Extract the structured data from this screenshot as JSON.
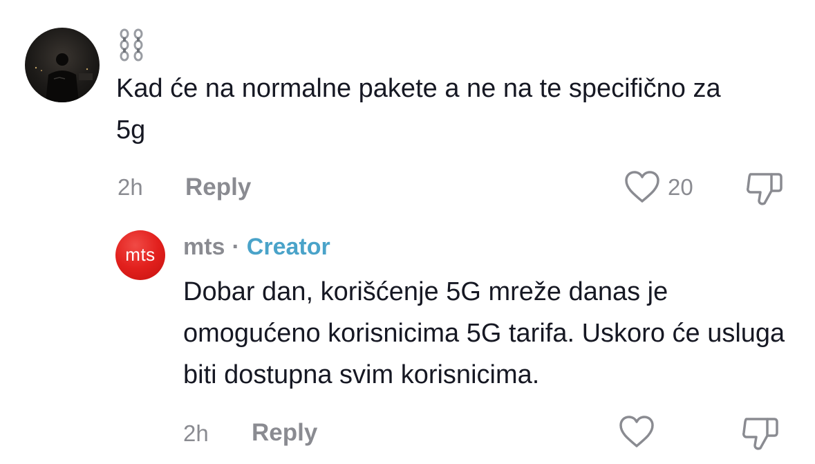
{
  "comments": [
    {
      "username": "⛓️",
      "text": "Kad će na normalne pakete a ne na te specifično za 5g",
      "time": "2h",
      "reply_label": "Reply",
      "like_count": "20",
      "avatar_icon": "person-silhouette-avatar"
    },
    {
      "username": "mts",
      "separator": "·",
      "badge": "Creator",
      "avatar_text": "mts",
      "text": "Dobar dan, korišćenje 5G mreže danas je omogućeno korisnicima 5G tarifa. Uskoro će usluga biti dostupna svim korisnicima.",
      "time": "2h",
      "reply_label": "Reply"
    }
  ],
  "icons": {
    "like": "heart-outline-icon",
    "dislike": "thumbs-down-outline-icon"
  },
  "colors": {
    "text": "#161823",
    "muted": "#8a8b91",
    "creator_badge": "#4aa3c9",
    "mts_brand": "#e2201d"
  }
}
